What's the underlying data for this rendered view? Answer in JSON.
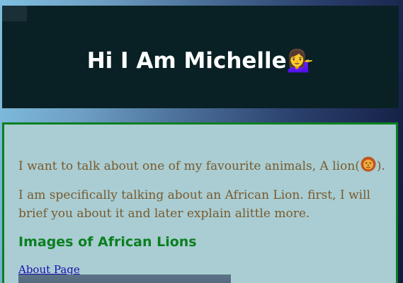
{
  "header": {
    "title": "Hi I Am Michelle",
    "emoji_icon": "woman-tipping-hand-icon"
  },
  "content": {
    "paragraph_1_before": "I want to talk about one of my favourite animals, A lion(",
    "paragraph_1_after": ").",
    "lion_icon": "lion-face-icon",
    "paragraph_2": "I am specifically talking about an African Lion. first, I will brief you about it and later explain alittle more.",
    "subheading": "Images of African Lions",
    "about_link": "About Page"
  },
  "colors": {
    "header_bg": "#092125",
    "content_bg": "#a9cdd3",
    "content_border": "#0b7f1f",
    "paragraph_text": "#7a5a2c",
    "subheading_text": "#0b7f1f",
    "link_text": "#1a0dab"
  }
}
